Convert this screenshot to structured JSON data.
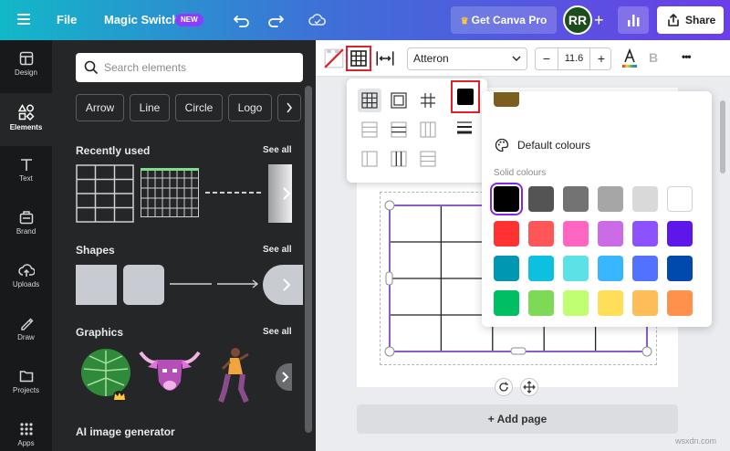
{
  "topbar": {
    "file_label": "File",
    "magic_switch_label": "Magic Switch",
    "new_badge": "NEW",
    "get_pro_label": "Get Canva Pro",
    "avatar_initials": "RR",
    "share_label": "Share",
    "brand_gradient": [
      "#12b8c8",
      "#3f6fd7",
      "#6b3ee8"
    ]
  },
  "rail": {
    "items": [
      {
        "label": "Design",
        "icon": "design-icon"
      },
      {
        "label": "Elements",
        "icon": "elements-icon"
      },
      {
        "label": "Text",
        "icon": "text-icon"
      },
      {
        "label": "Brand",
        "icon": "brand-icon"
      },
      {
        "label": "Uploads",
        "icon": "uploads-icon"
      },
      {
        "label": "Draw",
        "icon": "draw-icon"
      },
      {
        "label": "Projects",
        "icon": "projects-icon"
      },
      {
        "label": "Apps",
        "icon": "apps-icon"
      }
    ],
    "active": "Elements"
  },
  "panel": {
    "search_placeholder": "Search elements",
    "chips": [
      "Arrow",
      "Line",
      "Circle",
      "Logo"
    ],
    "recently_used_title": "Recently used",
    "shapes_title": "Shapes",
    "graphics_title": "Graphics",
    "ai_title": "AI image generator",
    "see_all": "See all"
  },
  "toolbar": {
    "font_name": "Atteron",
    "font_size": "11.6",
    "minus": "−",
    "plus": "+",
    "bold": "B",
    "more": "•••"
  },
  "colour_panel": {
    "header": "Default colours",
    "subheader": "Solid colours",
    "top_swatch": "#7c5f1e",
    "selected": "#000000",
    "swatches": [
      [
        "#000000",
        "#545454",
        "#737373",
        "#a6a6a6",
        "#d9d9d9",
        "#ffffff"
      ],
      [
        "#ff3131",
        "#ff5757",
        "#ff66c4",
        "#cb6ce6",
        "#8c52ff",
        "#5e17eb"
      ],
      [
        "#0097b2",
        "#0cc0df",
        "#5ce1e6",
        "#38b6ff",
        "#5271ff",
        "#004aad"
      ],
      [
        "#00bf63",
        "#7ed957",
        "#c1ff72",
        "#ffde59",
        "#ffbd59",
        "#ff914d"
      ]
    ]
  },
  "canvas": {
    "add_page_label": "+ Add page",
    "table_border_color": "#8b5cc7",
    "table_rows": 4,
    "table_cols": 5
  },
  "watermark": "wsxdn.com"
}
